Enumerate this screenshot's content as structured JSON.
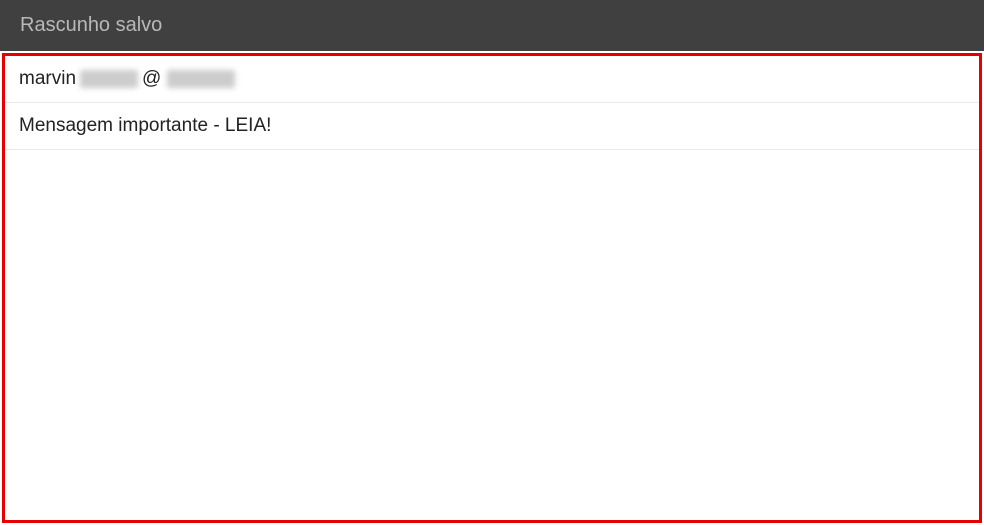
{
  "header": {
    "title": "Rascunho salvo"
  },
  "compose": {
    "recipient_visible_prefix": "marvin",
    "recipient_at": "@",
    "subject": "Mensagem importante - LEIA!",
    "body": ""
  }
}
